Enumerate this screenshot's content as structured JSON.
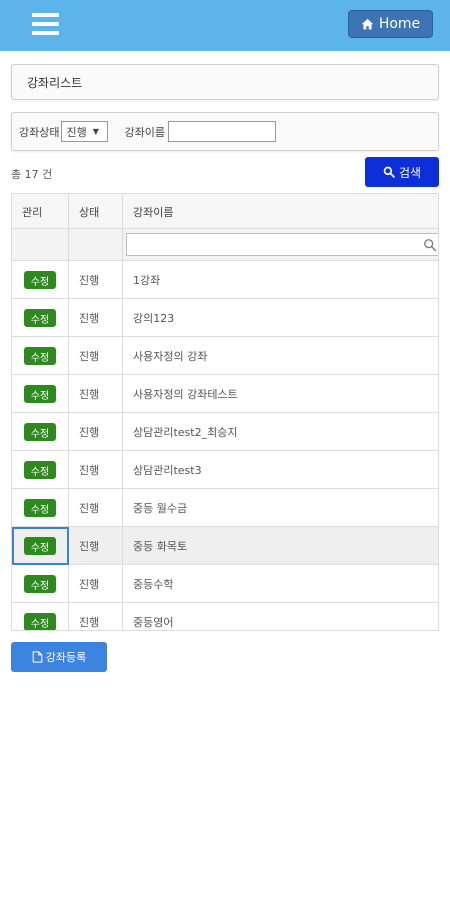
{
  "header": {
    "home_label": "Home"
  },
  "page": {
    "title": "강좌리스트"
  },
  "filter": {
    "status_label": "강좌상태",
    "status_selected": "진행",
    "name_label": "강좌이름",
    "name_value": ""
  },
  "summary": {
    "count_text": "총 17 건"
  },
  "search_button": {
    "label": "검색"
  },
  "table": {
    "headers": {
      "manage": "관리",
      "status": "상태",
      "name": "강좌이름"
    },
    "rows": [
      {
        "action": "수정",
        "status": "진행",
        "name": "1강좌"
      },
      {
        "action": "수정",
        "status": "진행",
        "name": "강의123"
      },
      {
        "action": "수정",
        "status": "진행",
        "name": "사용자정의 강좌"
      },
      {
        "action": "수정",
        "status": "진행",
        "name": "사용자정의 강좌테스트"
      },
      {
        "action": "수정",
        "status": "진행",
        "name": "상담관리test2_최승지"
      },
      {
        "action": "수정",
        "status": "진행",
        "name": "상담관리test3"
      },
      {
        "action": "수정",
        "status": "진행",
        "name": "중등 월수금"
      },
      {
        "action": "수정",
        "status": "진행",
        "name": "중등 화목토"
      },
      {
        "action": "수정",
        "status": "진행",
        "name": "중등수학"
      },
      {
        "action": "수정",
        "status": "진행",
        "name": "중등영어"
      }
    ]
  },
  "register_button": {
    "label": "강좌등록"
  },
  "icons": {
    "menu": "hamburger-icon",
    "home": "home-icon",
    "search": "search-icon",
    "register": "document-icon"
  },
  "colors": {
    "topbar": "#5cb4eb",
    "home_button": "#3f74b4",
    "search_button": "#0c2fd8",
    "edit_button": "#2e8a1e",
    "register_button": "#3d83e0"
  }
}
